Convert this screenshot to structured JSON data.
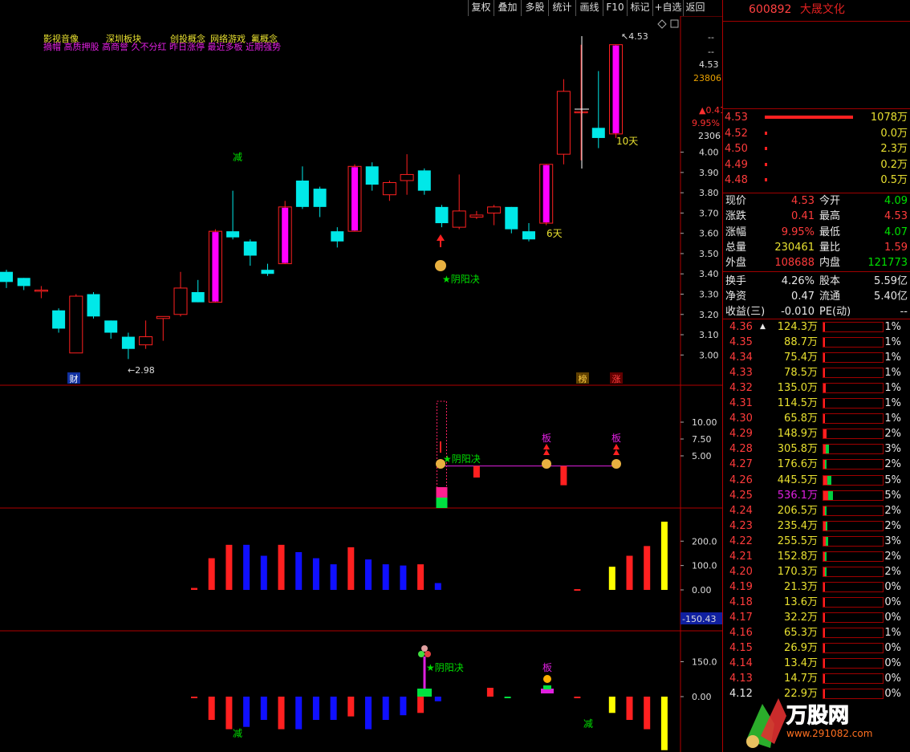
{
  "toolbar": {
    "buttons": [
      "复权",
      "叠加",
      "多股",
      "统计",
      "画线",
      "F10",
      "标记",
      "+自选",
      "返回"
    ]
  },
  "stock": {
    "code": "600892",
    "name": "大晟文化"
  },
  "tags": {
    "line1": [
      "影视音像",
      "深圳板块",
      "创投概念",
      "网络游戏",
      "氟概念"
    ],
    "line2": "摘帽 高质押股 高商誉 久不分红 昨日涨停 最近多板 近期强势"
  },
  "colors": {
    "up": "#ff2020",
    "down": "#00e8e8",
    "limit_up": "#ff00ff",
    "blue_bar": "#1010ff",
    "yellow_bar": "#ffff00",
    "grid": "#b00000"
  },
  "main_axis": {
    "ticks": [
      "4.53",
      "4.00",
      "3.90",
      "3.80",
      "3.70",
      "3.60",
      "3.50",
      "3.40",
      "3.30",
      "3.20",
      "3.10",
      "3.00"
    ],
    "info_price": "4.53",
    "info_vol": "23806",
    "info_change": "▲0.41",
    "info_pct": "9.95%",
    "info_amount": "2306",
    "dash1": "--",
    "dash2": "--"
  },
  "chart_data": [
    {
      "type": "candlestick",
      "title": "",
      "ylim": [
        2.93,
        4.6
      ],
      "candles": [
        {
          "o": 3.41,
          "c": 3.36,
          "h": 3.42,
          "l": 3.33
        },
        {
          "o": 3.38,
          "c": 3.34,
          "h": 3.38,
          "l": 3.32
        },
        {
          "o": 3.32,
          "c": 3.32,
          "h": 3.34,
          "l": 3.28
        },
        {
          "o": 3.22,
          "c": 3.13,
          "h": 3.23,
          "l": 3.11
        },
        {
          "o": 3.01,
          "c": 3.29,
          "h": 3.3,
          "l": 3.01
        },
        {
          "o": 3.3,
          "c": 3.19,
          "h": 3.31,
          "l": 3.18
        },
        {
          "o": 3.17,
          "c": 3.11,
          "h": 3.17,
          "l": 3.08
        },
        {
          "o": 3.09,
          "c": 3.03,
          "h": 3.11,
          "l": 2.98
        },
        {
          "o": 3.05,
          "c": 3.09,
          "h": 3.17,
          "l": 3.03
        },
        {
          "o": 3.18,
          "c": 3.19,
          "h": 3.19,
          "l": 3.07
        },
        {
          "o": 3.2,
          "c": 3.33,
          "h": 3.41,
          "l": 3.19
        },
        {
          "o": 3.31,
          "c": 3.26,
          "h": 3.37,
          "l": 3.26
        },
        {
          "o": 3.26,
          "c": 3.61,
          "h": 3.62,
          "l": 3.26,
          "limit": true
        },
        {
          "o": 3.61,
          "c": 3.58,
          "h": 3.81,
          "l": 3.57
        },
        {
          "o": 3.56,
          "c": 3.49,
          "h": 3.57,
          "l": 3.44
        },
        {
          "o": 3.42,
          "c": 3.4,
          "h": 3.45,
          "l": 3.39
        },
        {
          "o": 3.45,
          "c": 3.73,
          "h": 3.76,
          "l": 3.45,
          "limit": true
        },
        {
          "o": 3.86,
          "c": 3.73,
          "h": 3.93,
          "l": 3.72
        },
        {
          "o": 3.82,
          "c": 3.73,
          "h": 3.83,
          "l": 3.68
        },
        {
          "o": 3.61,
          "c": 3.56,
          "h": 3.63,
          "l": 3.53
        },
        {
          "o": 3.61,
          "c": 3.93,
          "h": 3.94,
          "l": 3.61,
          "limit": true
        },
        {
          "o": 3.93,
          "c": 3.84,
          "h": 3.95,
          "l": 3.81
        },
        {
          "o": 3.79,
          "c": 3.85,
          "h": 3.86,
          "l": 3.76
        },
        {
          "o": 3.86,
          "c": 3.89,
          "h": 3.99,
          "l": 3.79
        },
        {
          "o": 3.91,
          "c": 3.81,
          "h": 3.92,
          "l": 3.79
        },
        {
          "o": 3.73,
          "c": 3.65,
          "h": 3.74,
          "l": 3.63
        },
        {
          "o": 3.63,
          "c": 3.71,
          "h": 3.89,
          "l": 3.62
        },
        {
          "o": 3.68,
          "c": 3.69,
          "h": 3.71,
          "l": 3.67
        },
        {
          "o": 3.7,
          "c": 3.73,
          "h": 3.74,
          "l": 3.64
        },
        {
          "o": 3.73,
          "c": 3.62,
          "h": 3.73,
          "l": 3.6
        },
        {
          "o": 3.61,
          "c": 3.57,
          "h": 3.65,
          "l": 3.56
        },
        {
          "o": 3.65,
          "c": 3.94,
          "h": 3.94,
          "l": 3.64,
          "limit": true
        },
        {
          "o": 3.99,
          "c": 4.3,
          "h": 4.36,
          "l": 3.94
        },
        {
          "o": 4.2,
          "c": 4.2,
          "h": 4.53,
          "l": 3.96
        },
        {
          "o": 4.12,
          "c": 4.07,
          "h": 4.4,
          "l": 4.02
        },
        {
          "o": 4.09,
          "c": 4.53,
          "h": 4.53,
          "l": 4.07,
          "limit": true
        }
      ],
      "labels": {
        "low_value": "2.98",
        "high_value": "4.53",
        "days6": "6天",
        "days10": "10天",
        "reduce": "减",
        "signal": "★阴阳决",
        "cai": "财",
        "bang": "榜",
        "zhang": "涨"
      }
    },
    {
      "type": "bar",
      "title": "",
      "ylim": [
        0,
        12.5
      ],
      "yticks": [
        "10.00",
        "7.50",
        "5.00"
      ],
      "bars": [
        {
          "i": 25,
          "v": 1.5,
          "color": "#ff2090"
        },
        {
          "i": 25,
          "v": -1.0,
          "color": "#00e040"
        },
        {
          "i": 27,
          "v": 1.2,
          "color": "#ff2020"
        },
        {
          "i": 32,
          "v": 2.0,
          "color": "#ff2020"
        }
      ],
      "line_level": 3.5,
      "labels": {
        "signal": "★阴阳决",
        "ban1": "板",
        "ban2": "板"
      }
    },
    {
      "type": "bar",
      "title": "",
      "ylim": [
        -150.43,
        280
      ],
      "yticks": [
        "200.0",
        "100.0",
        "0.00"
      ],
      "current_value": "-150.43",
      "values": [
        8,
        130,
        185,
        185,
        140,
        185,
        155,
        130,
        105,
        175,
        125,
        105,
        100,
        105,
        28,
        null,
        null,
        null,
        null,
        null,
        null,
        null,
        3,
        null,
        95,
        140,
        180,
        280
      ],
      "start_index": 11,
      "colors": [
        "r",
        "r",
        "r",
        "b",
        "b",
        "r",
        "b",
        "b",
        "b",
        "r",
        "b",
        "b",
        "b",
        "r",
        "b",
        "x",
        "x",
        "x",
        "x",
        "x",
        "x",
        "x",
        "r",
        "x",
        "y",
        "r",
        "r",
        "y"
      ]
    },
    {
      "type": "bar",
      "title": "",
      "ylim": [
        -230,
        200
      ],
      "yticks": [
        "150.0",
        "0.00"
      ],
      "values": [
        0,
        -100,
        -140,
        -130,
        -100,
        -140,
        -140,
        -100,
        -100,
        -85,
        -140,
        -100,
        -80,
        -70,
        -20,
        null,
        null,
        38,
        0,
        null,
        null,
        null,
        0,
        null,
        -70,
        -100,
        -140,
        -230
      ],
      "start_index": 11,
      "colors": [
        "r",
        "r",
        "r",
        "b",
        "b",
        "r",
        "b",
        "b",
        "b",
        "r",
        "b",
        "b",
        "b",
        "r",
        "b",
        "x",
        "x",
        "r",
        "g",
        "x",
        "x",
        "x",
        "r",
        "x",
        "y",
        "r",
        "r",
        "y"
      ],
      "labels": {
        "reduce1": "减",
        "reduce2": "减",
        "signal": "★阴阳决",
        "ban": "板"
      }
    }
  ],
  "orderbook": [
    {
      "price": "4.53",
      "vol": "1078万",
      "bar": 1.0
    },
    {
      "price": "4.52",
      "vol": "0.0万",
      "bar": 0.0
    },
    {
      "price": "4.50",
      "vol": "2.3万",
      "bar": 0.0
    },
    {
      "price": "4.49",
      "vol": "0.2万",
      "bar": 0.0
    },
    {
      "price": "4.48",
      "vol": "0.5万",
      "bar": 0.0
    }
  ],
  "quote": [
    {
      "l1": "现价",
      "v1": "4.53",
      "c1": "red",
      "l2": "今开",
      "v2": "4.09",
      "c2": "green"
    },
    {
      "l1": "涨跌",
      "v1": "0.41",
      "c1": "red",
      "l2": "最高",
      "v2": "4.53",
      "c2": "red"
    },
    {
      "l1": "涨幅",
      "v1": "9.95%",
      "c1": "red",
      "l2": "最低",
      "v2": "4.07",
      "c2": "green"
    },
    {
      "l1": "总量",
      "v1": "230461",
      "c1": "yellow",
      "l2": "量比",
      "v2": "1.59",
      "c2": "red"
    },
    {
      "l1": "外盘",
      "v1": "108688",
      "c1": "red",
      "l2": "内盘",
      "v2": "121773",
      "c2": "green"
    },
    {
      "l1": "换手",
      "v1": "4.26%",
      "c1": "white",
      "l2": "股本",
      "v2": "5.59亿",
      "c2": "white"
    },
    {
      "l1": "净资",
      "v1": "0.47",
      "c1": "white",
      "l2": "流通",
      "v2": "5.40亿",
      "c2": "white"
    },
    {
      "l1": "收益(三)",
      "v1": "-0.010",
      "c1": "white",
      "l2": "PE(动)",
      "v2": "--",
      "c2": "white"
    }
  ],
  "volume_profile": [
    {
      "price": "4.36",
      "vol": "124.3万",
      "pct": "1%",
      "fill": 0.03,
      "mark": "▲"
    },
    {
      "price": "4.35",
      "vol": "88.7万",
      "pct": "1%",
      "fill": 0.03
    },
    {
      "price": "4.34",
      "vol": "75.4万",
      "pct": "1%",
      "fill": 0.03
    },
    {
      "price": "4.33",
      "vol": "78.5万",
      "pct": "1%",
      "fill": 0.03
    },
    {
      "price": "4.32",
      "vol": "135.0万",
      "pct": "1%",
      "fill": 0.04
    },
    {
      "price": "4.31",
      "vol": "114.5万",
      "pct": "1%",
      "fill": 0.03
    },
    {
      "price": "4.30",
      "vol": "65.8万",
      "pct": "1%",
      "fill": 0.02
    },
    {
      "price": "4.29",
      "vol": "148.9万",
      "pct": "2%",
      "fill": 0.05
    },
    {
      "price": "4.28",
      "vol": "305.8万",
      "pct": "3%",
      "fill": 0.09,
      "green": true
    },
    {
      "price": "4.27",
      "vol": "176.6万",
      "pct": "2%",
      "fill": 0.05,
      "green": true
    },
    {
      "price": "4.26",
      "vol": "445.5万",
      "pct": "5%",
      "fill": 0.13,
      "green": true
    },
    {
      "price": "4.25",
      "vol": "536.1万",
      "pct": "5%",
      "fill": 0.16,
      "green": true,
      "hl": true
    },
    {
      "price": "4.24",
      "vol": "206.5万",
      "pct": "2%",
      "fill": 0.06,
      "green": true
    },
    {
      "price": "4.23",
      "vol": "235.4万",
      "pct": "2%",
      "fill": 0.07,
      "green": true
    },
    {
      "price": "4.22",
      "vol": "255.5万",
      "pct": "3%",
      "fill": 0.08,
      "green": true
    },
    {
      "price": "4.21",
      "vol": "152.8万",
      "pct": "2%",
      "fill": 0.05,
      "green": true
    },
    {
      "price": "4.20",
      "vol": "170.3万",
      "pct": "2%",
      "fill": 0.05,
      "green": true
    },
    {
      "price": "4.19",
      "vol": "21.3万",
      "pct": "0%",
      "fill": 0.01
    },
    {
      "price": "4.18",
      "vol": "13.6万",
      "pct": "0%",
      "fill": 0.01
    },
    {
      "price": "4.17",
      "vol": "32.2万",
      "pct": "0%",
      "fill": 0.01
    },
    {
      "price": "4.16",
      "vol": "65.3万",
      "pct": "1%",
      "fill": 0.02
    },
    {
      "price": "4.15",
      "vol": "26.9万",
      "pct": "0%",
      "fill": 0.01
    },
    {
      "price": "4.14",
      "vol": "13.4万",
      "pct": "0%",
      "fill": 0.01
    },
    {
      "price": "4.13",
      "vol": "14.7万",
      "pct": "0%",
      "fill": 0.01
    },
    {
      "price": "4.12",
      "vol": "22.9万",
      "pct": "0%",
      "fill": 0.01,
      "white": true
    }
  ],
  "watermark": {
    "brand": "万股网",
    "url": "www.291082.com"
  }
}
